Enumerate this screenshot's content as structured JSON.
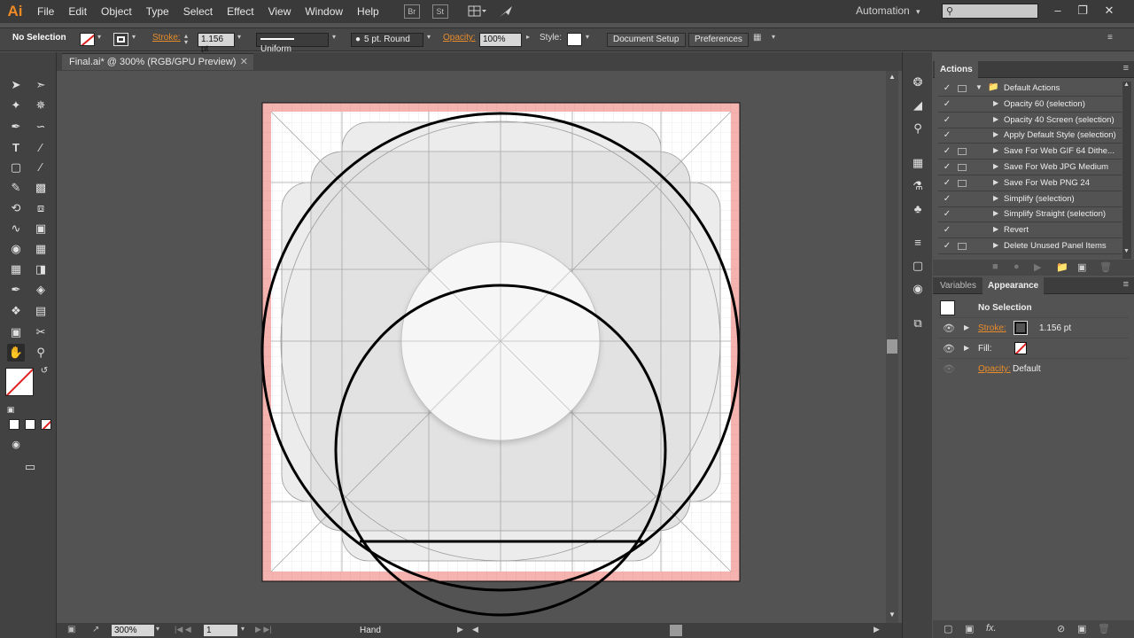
{
  "app": {
    "logo": "Ai",
    "workspace": "Automation",
    "workspace_caret": "▾"
  },
  "menu": [
    "File",
    "Edit",
    "Object",
    "Type",
    "Select",
    "Effect",
    "View",
    "Window",
    "Help"
  ],
  "menubar_icons": {
    "bridge": "Br",
    "stock": "St"
  },
  "control": {
    "selection": "No Selection",
    "stroke_label": "Stroke:",
    "stroke_weight": "1.156 pt",
    "profile": "Uniform",
    "brush": "5 pt. Round",
    "opacity_label": "Opacity:",
    "opacity": "100%",
    "style_label": "Style:",
    "document_setup": "Document Setup",
    "preferences": "Preferences"
  },
  "document": {
    "tab_title": "Final.ai* @ 300% (RGB/GPU Preview)"
  },
  "status": {
    "zoom": "300%",
    "page": "1",
    "tool": "Hand"
  },
  "actions_panel": {
    "title": "Actions",
    "items": [
      {
        "label": "Default Actions",
        "folder": true,
        "indent": 0,
        "dialog": true
      },
      {
        "label": "Opacity 60 (selection)",
        "dialog": false
      },
      {
        "label": "Opacity 40 Screen (selection)",
        "dialog": false
      },
      {
        "label": "Apply Default Style (selection)",
        "dialog": false
      },
      {
        "label": "Save For Web GIF 64 Dithe...",
        "dialog": true
      },
      {
        "label": "Save For Web JPG Medium",
        "dialog": true
      },
      {
        "label": "Save For Web PNG 24",
        "dialog": true
      },
      {
        "label": "Simplify (selection)",
        "dialog": false
      },
      {
        "label": "Simplify Straight (selection)",
        "dialog": false
      },
      {
        "label": "Revert",
        "dialog": false
      },
      {
        "label": "Delete Unused Panel Items",
        "dialog": true
      }
    ]
  },
  "appearance_panel": {
    "tab_variables": "Variables",
    "tab_appearance": "Appearance",
    "selection": "No Selection",
    "stroke_label": "Stroke:",
    "stroke_value": "1.156 pt",
    "fill_label": "Fill:",
    "opacity_label": "Opacity:",
    "opacity_value": "Default",
    "fx_label": "fx."
  },
  "colors": {
    "accent_orange": "#e88c2a",
    "bleed": "#f4b3ae",
    "panel_bg": "#535353"
  }
}
